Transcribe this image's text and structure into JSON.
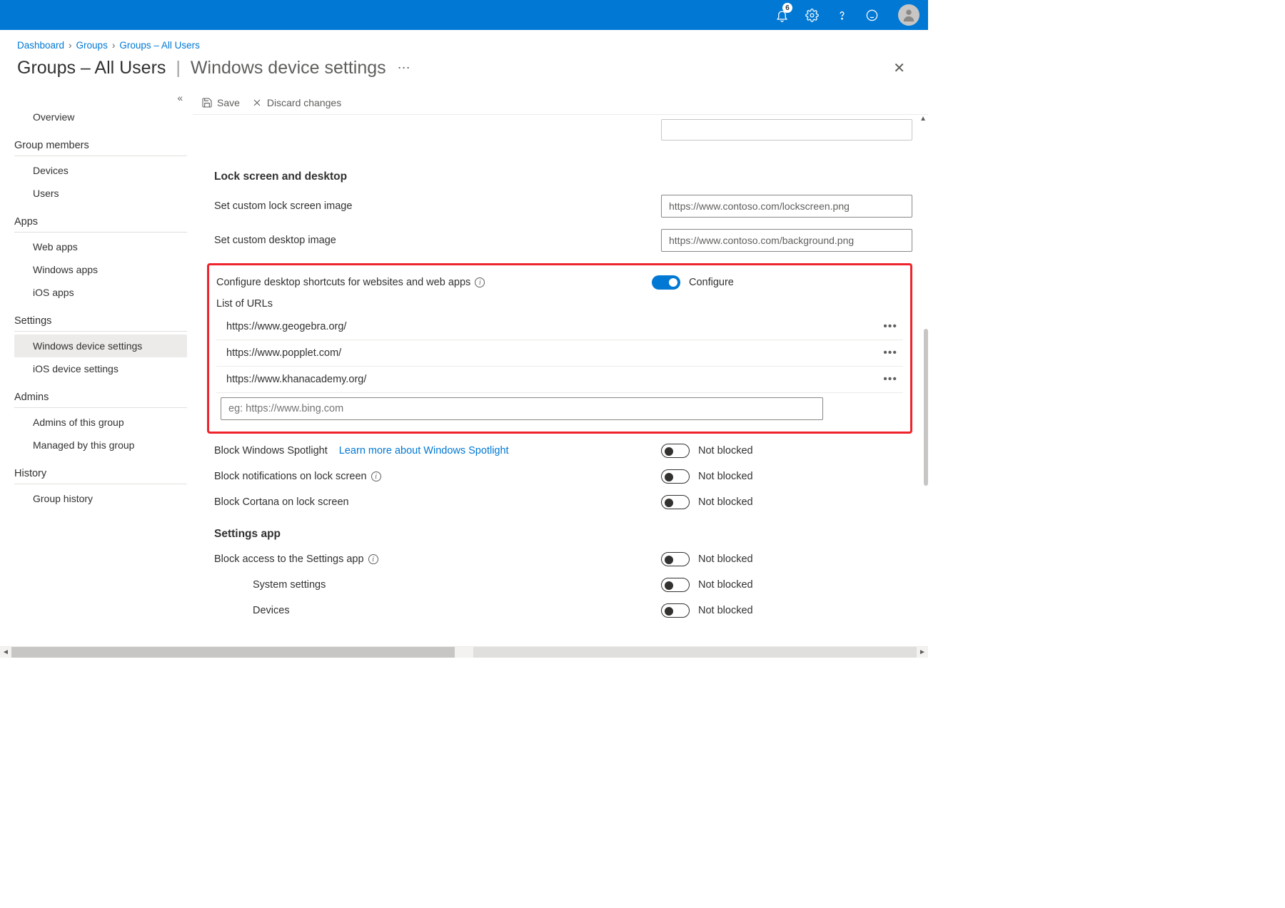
{
  "topbar": {
    "notification_count": "6"
  },
  "breadcrumb": {
    "items": [
      "Dashboard",
      "Groups",
      "Groups – All Users"
    ]
  },
  "page_title": {
    "main": "Groups – All Users",
    "sub": "Windows device settings"
  },
  "toolbar": {
    "save": "Save",
    "discard": "Discard changes"
  },
  "sidebar": {
    "top_item": "Overview",
    "sections": [
      {
        "title": "Group members",
        "items": [
          "Devices",
          "Users"
        ]
      },
      {
        "title": "Apps",
        "items": [
          "Web apps",
          "Windows apps",
          "iOS apps"
        ]
      },
      {
        "title": "Settings",
        "items": [
          "Windows device settings",
          "iOS device settings"
        ],
        "active_index": 0
      },
      {
        "title": "Admins",
        "items": [
          "Admins of this group",
          "Managed by this group"
        ]
      },
      {
        "title": "History",
        "items": [
          "Group history"
        ]
      }
    ]
  },
  "sections": {
    "lock": {
      "title": "Lock screen and desktop",
      "lockscreen_label": "Set custom lock screen image",
      "lockscreen_value": "https://www.contoso.com/lockscreen.png",
      "desktop_label": "Set custom desktop image",
      "desktop_value": "https://www.contoso.com/background.png",
      "shortcuts_label": "Configure desktop shortcuts for websites and web apps",
      "shortcuts_toggle_on": true,
      "shortcuts_toggle_label": "Configure",
      "list_header": "List of URLs",
      "urls": [
        "https://www.geogebra.org/",
        "https://www.popplet.com/",
        "https://www.khanacademy.org/"
      ],
      "url_placeholder": "eg: https://www.bing.com",
      "spotlight_label": "Block Windows Spotlight",
      "spotlight_link": "Learn more about Windows Spotlight",
      "spotlight_state": "Not blocked",
      "notifications_label": "Block notifications on lock screen",
      "notifications_state": "Not blocked",
      "cortana_label": "Block Cortana on lock screen",
      "cortana_state": "Not blocked"
    },
    "settings_app": {
      "title": "Settings app",
      "block_access_label": "Block access to the Settings app",
      "block_access_state": "Not blocked",
      "system_label": "System settings",
      "system_state": "Not blocked",
      "devices_label": "Devices",
      "devices_state": "Not blocked"
    }
  }
}
